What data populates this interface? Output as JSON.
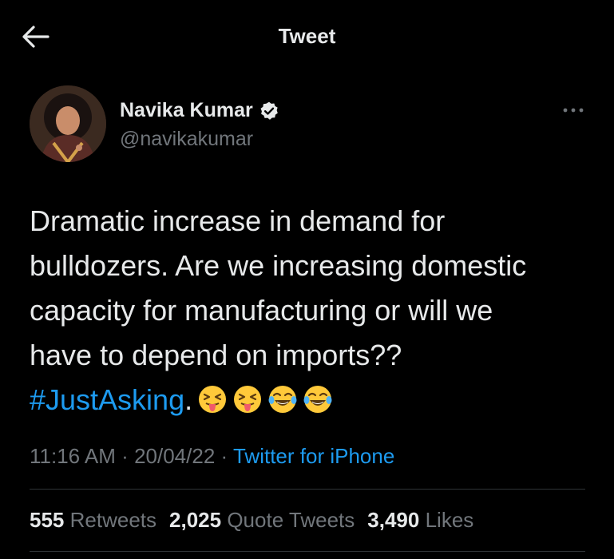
{
  "header": {
    "title": "Tweet",
    "back_icon": "arrow-left-icon"
  },
  "author": {
    "name": "Navika Kumar",
    "handle": "@navikakumar",
    "verified": true
  },
  "tweet": {
    "text": "Dramatic increase in demand for\nbulldozers. Are we increasing domestic\ncapacity for manufacturing or will we\nhave to depend on imports??",
    "hashtag": "#JustAsking",
    "after_hashtag": ".",
    "emojis": [
      "winking-tongue-face",
      "winking-tongue-face",
      "tears-of-joy-face",
      "tears-of-joy-face"
    ]
  },
  "meta": {
    "time": "11:16 AM",
    "date": "20/04/22",
    "source": "Twitter for iPhone",
    "separator": "·"
  },
  "stats": {
    "retweets_count": "555",
    "retweets_label": "Retweets",
    "quotes_count": "2,025",
    "quotes_label": "Quote Tweets",
    "likes_count": "3,490",
    "likes_label": "Likes"
  },
  "colors": {
    "background": "#000000",
    "text": "#e7e9ea",
    "muted": "#71767b",
    "accent": "#1d9bf0",
    "divider": "#2f3336"
  }
}
